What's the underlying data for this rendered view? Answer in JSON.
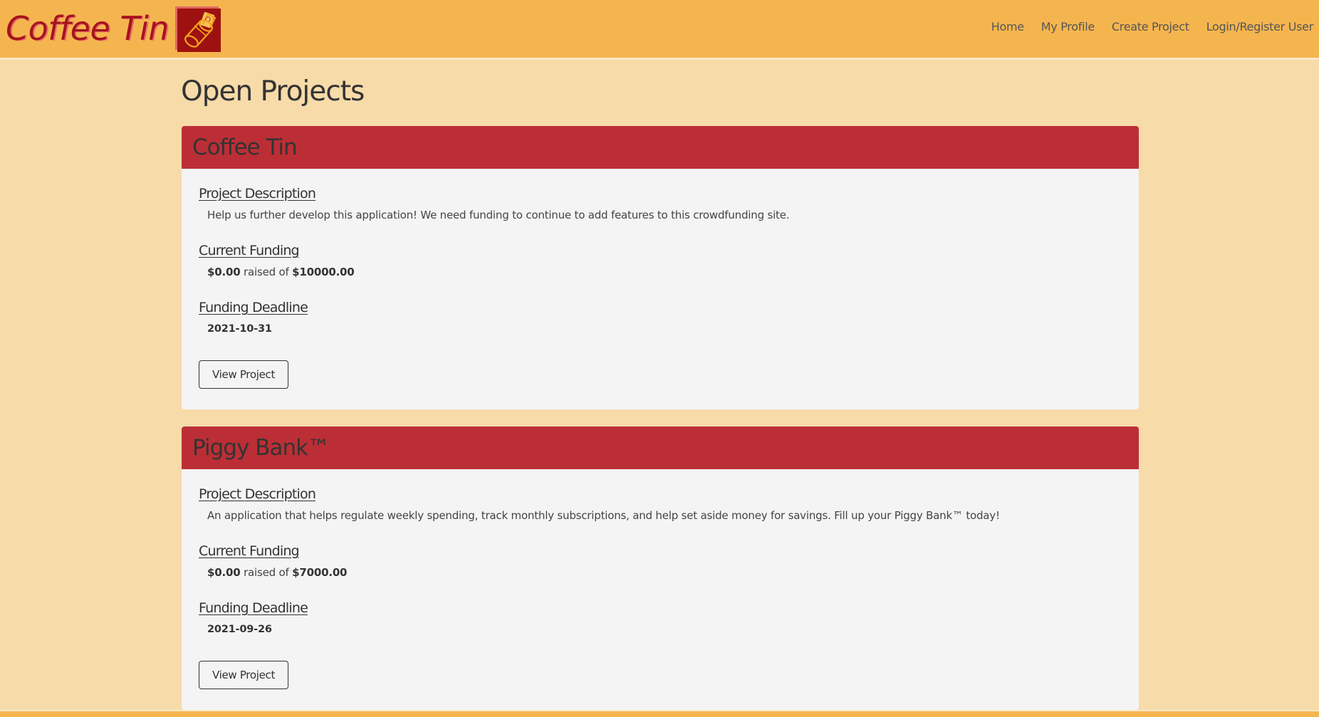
{
  "navbar": {
    "brand_text": "Coffee Tin",
    "logo_icon": "coffee-tin-money-icon",
    "links": [
      {
        "label": "Home"
      },
      {
        "label": "My Profile"
      },
      {
        "label": "Create Project"
      },
      {
        "label": "Login/Register User"
      }
    ]
  },
  "page": {
    "title": "Open Projects"
  },
  "labels": {
    "description": "Project Description",
    "funding": "Current Funding",
    "deadline": "Funding Deadline",
    "raised_of": "raised of",
    "view_button": "View Project"
  },
  "projects": [
    {
      "title": "Coffee Tin",
      "description": "Help us further develop this application! We need funding to continue to add features to this crowdfunding site.",
      "current_funding": "$0.00",
      "goal": "$10000.00",
      "deadline": "2021-10-31"
    },
    {
      "title": "Piggy Bank™",
      "description": "An application that helps regulate weekly spending, track monthly subscriptions, and help set aside money for savings. Fill up your Piggy Bank™ today!",
      "current_funding": "$0.00",
      "goal": "$7000.00",
      "deadline": "2021-09-26"
    }
  ],
  "colors": {
    "navbar_bg": "#F5B54E",
    "page_bg": "#F7DBA9",
    "card_header_bg": "#BC2E35",
    "card_body_bg": "#F4F4F4",
    "brand_red": "#A5141C"
  }
}
